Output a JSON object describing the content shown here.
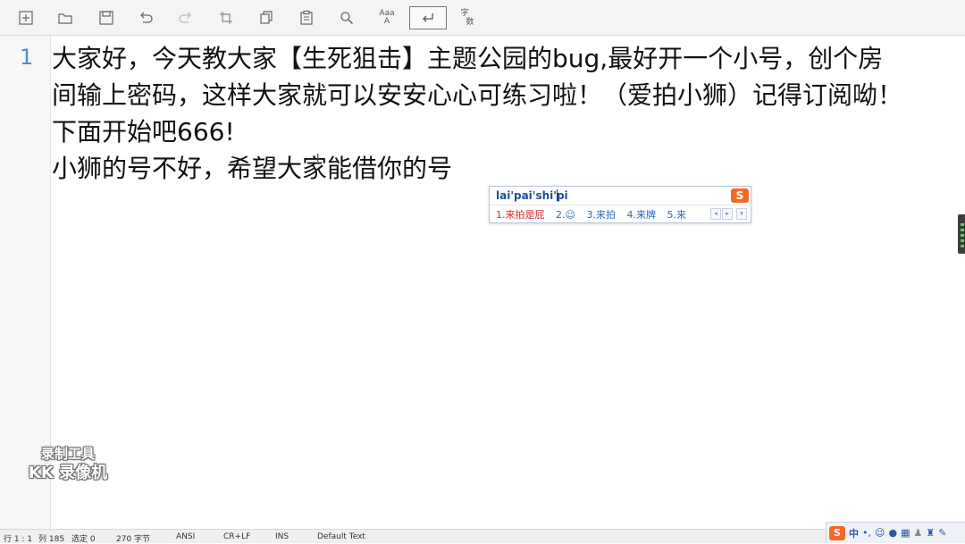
{
  "toolbar": {
    "buttons": [
      {
        "name": "new-file",
        "icon": "plus-box-icon"
      },
      {
        "name": "open-file",
        "icon": "folder-icon"
      },
      {
        "name": "save-file",
        "icon": "floppy-icon"
      },
      {
        "name": "undo",
        "icon": "undo-icon"
      },
      {
        "name": "redo",
        "icon": "redo-icon"
      },
      {
        "name": "crop",
        "icon": "crop-icon"
      },
      {
        "name": "copy",
        "icon": "copy-icon"
      },
      {
        "name": "paste",
        "icon": "clipboard-icon"
      },
      {
        "name": "find",
        "icon": "search-icon"
      },
      {
        "name": "replace",
        "icon": "replace-icon"
      },
      {
        "name": "word-wrap",
        "icon": "return-icon",
        "active": true
      },
      {
        "name": "word-count",
        "icon": "word-count-icon"
      }
    ],
    "replace_glyph": "AaaA",
    "wordcount_glyph_top": "字",
    "wordcount_glyph_bottom": "数"
  },
  "editor": {
    "line_number": "1",
    "lines": [
      "大家好，今天教大家【生死狙击】主题公园的bug,最好开一个小号，创个房",
      "间输上密码，这样大家就可以安安心心可练习啦！（爱拍小狮）记得订阅呦！",
      "下面开始吧666!",
      " 小狮的号不好，希望大家能借你的号"
    ]
  },
  "ime": {
    "input": "lai'pai'shi'pi",
    "logo": "S",
    "candidates": [
      "1.来拍是屁",
      "2.☺",
      "3.来拍",
      "4.来牌",
      "5.来"
    ]
  },
  "watermark": {
    "line1": "录制工具",
    "line2": "KK 录像机"
  },
  "statusbar": {
    "position": "行 1 : 1",
    "column": "列 185",
    "selected": "选定 0",
    "bytes": "270 字节",
    "encoding": "ANSI",
    "line_ending": "CR+LF",
    "mode": "INS",
    "syntax": "Default Text"
  },
  "tray": {
    "ime_logo": "S",
    "lang": "中",
    "punct": "•,",
    "icons": [
      "emoji-icon",
      "mic-icon",
      "keyboard-icon",
      "user-icon",
      "shirt-icon",
      "wrench-icon"
    ]
  },
  "colors": {
    "line_number": "#4a8ed0",
    "ime_first_candidate": "#d42a2a",
    "ime_candidate": "#2a6bb8",
    "sogou_orange": "#f06a2a"
  }
}
